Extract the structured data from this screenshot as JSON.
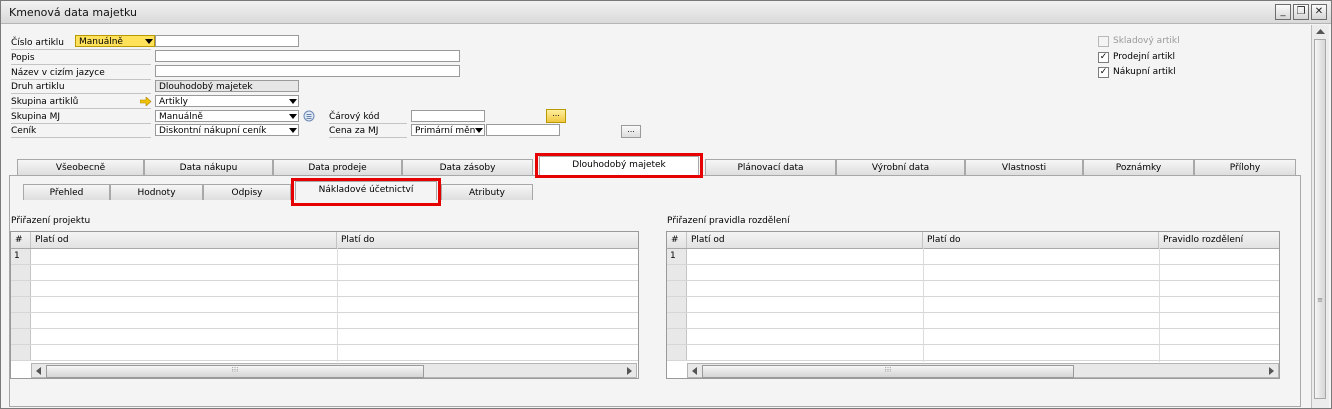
{
  "window": {
    "title": "Kmenová data majetku"
  },
  "fields": {
    "cislo_artiklu_label": "Číslo artiklu",
    "cislo_artiklu_series": "Manuálně",
    "cislo_artiklu_value": "",
    "popis_label": "Popis",
    "popis_value": "",
    "nazev_cizi_label": "Název v cizím jazyce",
    "nazev_cizi_value": "",
    "druh_artiklu_label": "Druh artiklu",
    "druh_artiklu_value": "Dlouhodobý majetek",
    "skupina_artiklu_label": "Skupina artiklů",
    "skupina_artiklu_value": "Artikly",
    "skupina_mj_label": "Skupina MJ",
    "skupina_mj_value": "Manuálně",
    "cenik_label": "Ceník",
    "cenik_value": "Diskontní nákupní ceník",
    "carovy_kod_label": "Čárový kód",
    "carovy_kod_value": "",
    "cena_za_mj_label": "Cena za MJ",
    "cena_za_mj_currency": "Primární měn",
    "cena_za_mj_value": "",
    "more_button": "..."
  },
  "checkboxes": [
    {
      "label": "Skladový artikl",
      "checked": false,
      "disabled": true
    },
    {
      "label": "Prodejní artikl",
      "checked": true,
      "disabled": false
    },
    {
      "label": "Nákupní artikl",
      "checked": true,
      "disabled": false
    }
  ],
  "tabs": [
    "Všeobecně",
    "Data nákupu",
    "Data prodeje",
    "Data zásoby",
    "Dlouhodobý majetek",
    "Plánovací data",
    "Výrobní data",
    "Vlastnosti",
    "Poznámky",
    "Přílohy"
  ],
  "active_tab": "Dlouhodobý majetek",
  "subtabs": [
    "Přehled",
    "Hodnoty",
    "Odpisy",
    "Nákladové účetnictví",
    "Atributy"
  ],
  "active_subtab": "Nákladové účetnictví",
  "project_grid": {
    "title": "Přiřazení projektu",
    "columns": [
      "#",
      "Platí od",
      "Platí do"
    ],
    "rows": [
      [
        "1",
        "",
        ""
      ]
    ]
  },
  "distribution_grid": {
    "title": "Přiřazení pravidla rozdělení",
    "columns": [
      "#",
      "Platí od",
      "Platí do",
      "Pravidlo rozdělení"
    ],
    "rows": [
      [
        "1",
        "",
        "",
        ""
      ]
    ]
  },
  "colors": {
    "highlight": "#e60000",
    "series_field": "#ffe15a"
  },
  "icons": [
    "minimize-icon",
    "restore-icon",
    "close-icon",
    "link-arrow-icon",
    "uom-info-icon",
    "checkmark-icon"
  ]
}
